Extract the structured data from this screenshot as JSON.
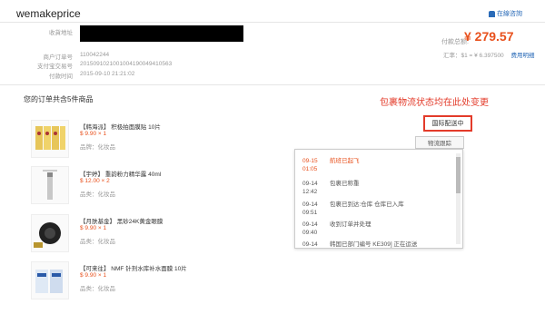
{
  "header": {
    "logo": "wemakeprice",
    "chat_label": "在線咨詢"
  },
  "order_info": {
    "rows": [
      {
        "label": "收貨地址",
        "value": ""
      },
      {
        "label": "商户订单号",
        "value": "110042244"
      },
      {
        "label": "支付宝交易号",
        "value": "2015091021001004190049410563"
      },
      {
        "label": "付款时间",
        "value": "2015-09-10 21:21:02"
      }
    ]
  },
  "payment": {
    "label": "付款总额:",
    "amount": "¥ 279.57",
    "fx_text": "汇率：$1 = ¥ 6.397500",
    "fx_link": "费用明细"
  },
  "order": {
    "title": "您的订单共含5件商品"
  },
  "annotation": "包裹物流状态均在此处变更",
  "status": {
    "label": "国际配送中",
    "track_button": "物流跟踪"
  },
  "tracking": [
    {
      "date": "09-15",
      "time": "01:05",
      "desc": "航班已起飞",
      "highlight": true
    },
    {
      "date": "09-14",
      "time": "12:42",
      "desc": "包裹已称重",
      "highlight": false
    },
    {
      "date": "09-14",
      "time": "09:51",
      "desc": "包裹已到达:仓库 仓库已入库",
      "highlight": false
    },
    {
      "date": "09-14",
      "time": "09:40",
      "desc": "收到订单并处理",
      "highlight": false
    },
    {
      "date": "09-14",
      "time": "",
      "desc": "韩国已部门编号 KE309] 正在运送",
      "highlight": false
    }
  ],
  "products": [
    {
      "name": "【韩海派】 积极拍面膜贴 10片",
      "price": "$ 9.90 × 1",
      "category": "品牌：化妆品"
    },
    {
      "name": "【宇婷】 重韵粉力精华露 40ml",
      "price": "$ 12.00 × 2",
      "category": "品类：化妆品"
    },
    {
      "name": "【月肤基金】 黑砂24K黄金眼膜",
      "price": "$ 9.90 × 1",
      "category": "品类：化妆品"
    },
    {
      "name": "【可来往】 NMF 针剂水库补水面膜 10片",
      "price": "$ 9.90 × 1",
      "category": "品类：化妆品"
    }
  ]
}
